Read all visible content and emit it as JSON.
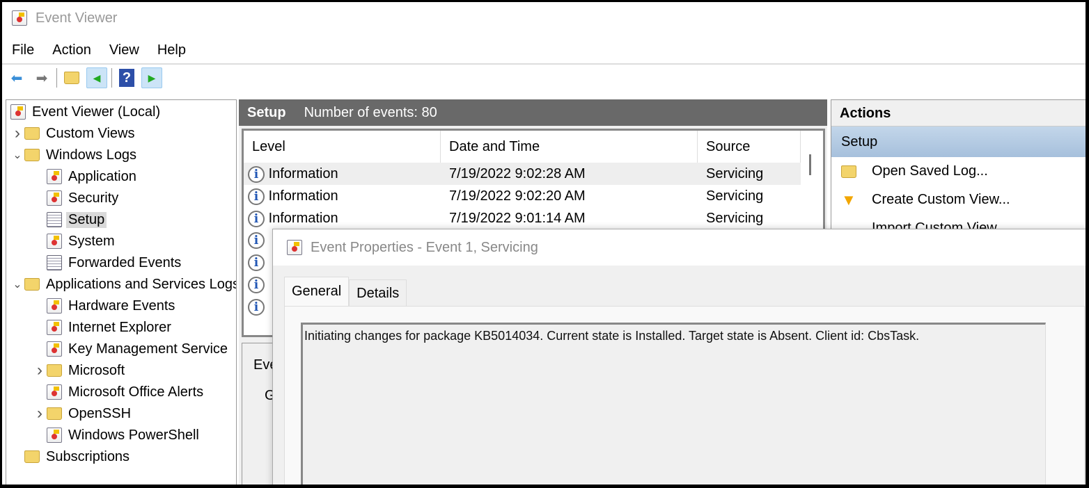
{
  "window": {
    "title": "Event Viewer"
  },
  "menu": [
    "File",
    "Action",
    "View",
    "Help"
  ],
  "toolbar": {
    "icons": [
      "back-arrow-icon",
      "forward-arrow-icon",
      "open-folder-icon",
      "show-hide-console-tree-icon",
      "help-icon",
      "show-hide-action-pane-icon"
    ]
  },
  "tree": {
    "root": "Event Viewer (Local)",
    "items": [
      {
        "label": "Custom Views",
        "level": 1,
        "expander": "collapsed",
        "icon": "folder"
      },
      {
        "label": "Windows Logs",
        "level": 1,
        "expander": "expanded",
        "icon": "folder"
      },
      {
        "label": "Application",
        "level": 2,
        "icon": "log"
      },
      {
        "label": "Security",
        "level": 2,
        "icon": "log"
      },
      {
        "label": "Setup",
        "level": 2,
        "icon": "plain",
        "selected": true
      },
      {
        "label": "System",
        "level": 2,
        "icon": "log"
      },
      {
        "label": "Forwarded Events",
        "level": 2,
        "icon": "plain"
      },
      {
        "label": "Applications and Services Logs",
        "level": 1,
        "expander": "expanded",
        "icon": "folder"
      },
      {
        "label": "Hardware Events",
        "level": 2,
        "icon": "log"
      },
      {
        "label": "Internet Explorer",
        "level": 2,
        "icon": "log"
      },
      {
        "label": "Key Management Service",
        "level": 2,
        "icon": "log"
      },
      {
        "label": "Microsoft",
        "level": 2,
        "expander": "collapsed",
        "icon": "folder"
      },
      {
        "label": "Microsoft Office Alerts",
        "level": 2,
        "icon": "log"
      },
      {
        "label": "OpenSSH",
        "level": 2,
        "expander": "collapsed",
        "icon": "folder"
      },
      {
        "label": "Windows PowerShell",
        "level": 2,
        "icon": "log"
      },
      {
        "label": "Subscriptions",
        "level": 1,
        "icon": "folder"
      }
    ]
  },
  "middle": {
    "log_name": "Setup",
    "count_text": "Number of events: 80",
    "columns": [
      "Level",
      "Date and Time",
      "Source"
    ],
    "rows": [
      {
        "level": "Information",
        "datetime": "7/19/2022 9:02:28 AM",
        "source": "Servicing"
      },
      {
        "level": "Information",
        "datetime": "7/19/2022 9:02:20 AM",
        "source": "Servicing"
      },
      {
        "level": "Information",
        "datetime": "7/19/2022 9:01:14 AM",
        "source": "Servicing"
      }
    ],
    "hidden_row_icons": 4,
    "lower_tab_partial": "Eve",
    "lower_general_partial": "G"
  },
  "actions": {
    "title": "Actions",
    "section": "Setup",
    "items": [
      {
        "label": "Open Saved Log...",
        "icon": "open-folder-icon"
      },
      {
        "label": "Create Custom View...",
        "icon": "filter-icon"
      },
      {
        "label": "Import Custom View...",
        "icon": ""
      }
    ]
  },
  "dialog": {
    "title": "Event Properties - Event 1, Servicing",
    "tabs": [
      "General",
      "Details"
    ],
    "active_tab": "General",
    "message": "Initiating changes for package KB5014034. Current state is Installed. Target state is Absent. Client id: CbsTask."
  },
  "colors": {
    "header_bar": "#696969",
    "action_selected": "#b5cce6",
    "info_icon": "#2257b5"
  }
}
